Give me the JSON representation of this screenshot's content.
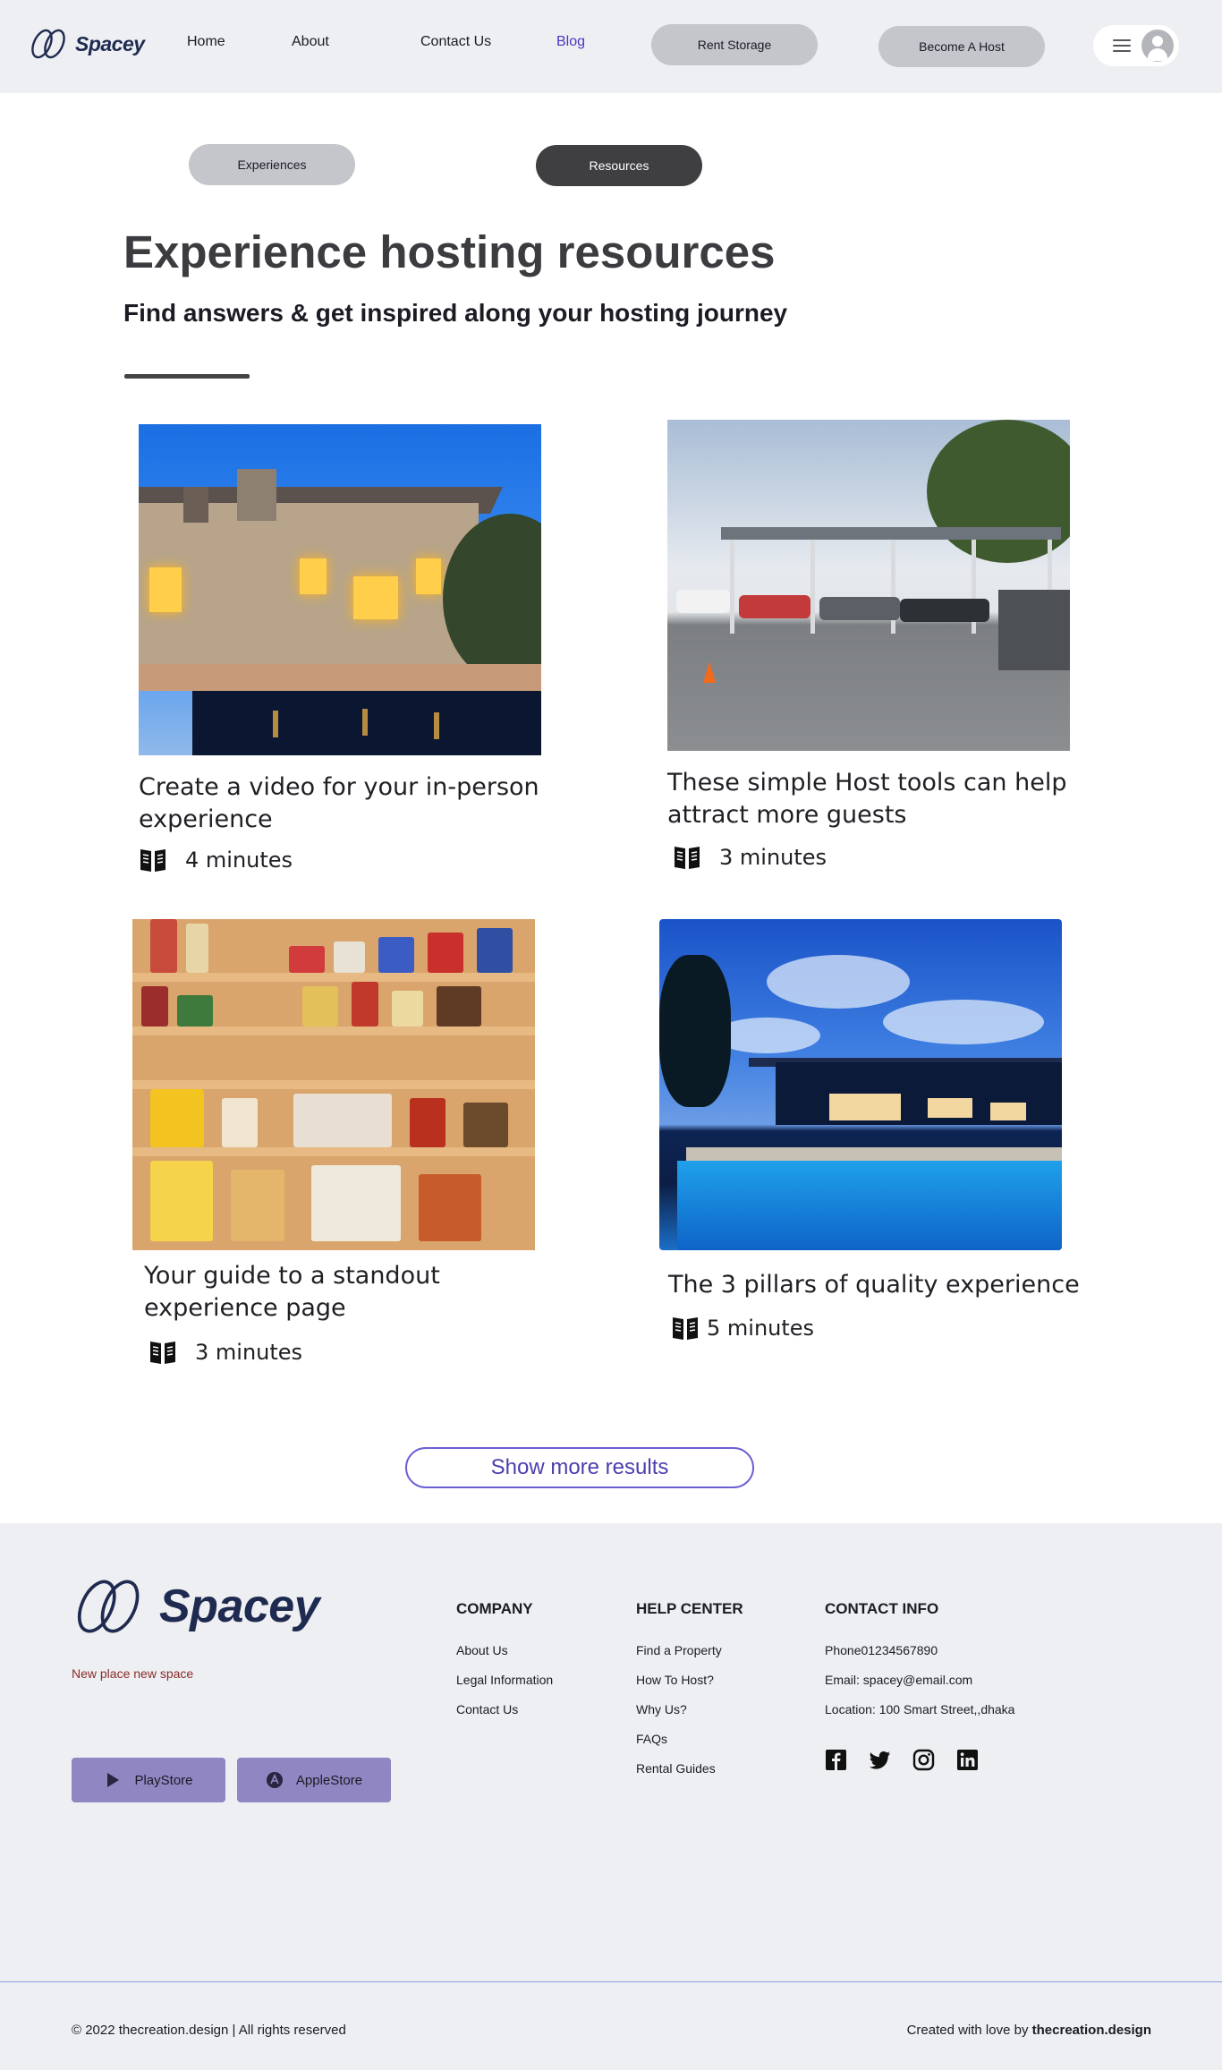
{
  "brand": {
    "name": "Spacey"
  },
  "nav": {
    "links": [
      "Home",
      "About",
      "Contact Us",
      "Blog"
    ],
    "active": "Blog",
    "rent_storage": "Rent Storage",
    "become_host": "Become A Host"
  },
  "tabs": [
    "Experiences",
    "Resources"
  ],
  "hero": {
    "title": "Experience hosting resources",
    "subtitle": "Find answers & get inspired along your hosting journey"
  },
  "cards": [
    {
      "title": "Create a video for your in-person experience",
      "read_time": "4 minutes",
      "image": "house-with-pool-photo"
    },
    {
      "title": "These simple Host tools can help attract more guests",
      "read_time": "3 minutes",
      "image": "carport-storage-photo"
    },
    {
      "title": "Your guide to a standout experience page",
      "read_time": "3 minutes",
      "image": "pantry-shelves-photo"
    },
    {
      "title": "The 3 pillars of quality experience",
      "read_time": "5 minutes",
      "image": "resort-pool-photo"
    }
  ],
  "show_more": "Show more results",
  "footer": {
    "brand": "Spacey",
    "tagline": "New place new  space",
    "store_buttons": [
      "PlayStore",
      "AppleStore"
    ],
    "company": {
      "title": "COMPANY",
      "items": [
        "About Us",
        "Legal Information",
        "Contact Us"
      ]
    },
    "help": {
      "title": "HELP CENTER",
      "items": [
        "Find a Property",
        "How To Host?",
        "Why Us?",
        "FAQs",
        "Rental Guides"
      ]
    },
    "contact": {
      "title": "CONTACT INFO",
      "items": [
        "Phone01234567890",
        "Email: spacey@email.com",
        "Location: 100 Smart Street,,dhaka"
      ]
    },
    "socials": [
      "facebook-icon",
      "twitter-icon",
      "instagram-icon",
      "linkedin-icon"
    ],
    "copyright": "© 2022 thecreation.design | All rights reserved",
    "credit_prefix": "Created with love by ",
    "credit_name": "thecreation.design"
  },
  "colors": {
    "accent": "#4636c4",
    "footer_bg": "#eeeff2",
    "store_button": "#8f86c2",
    "brand_navy": "#1e2a4f"
  }
}
